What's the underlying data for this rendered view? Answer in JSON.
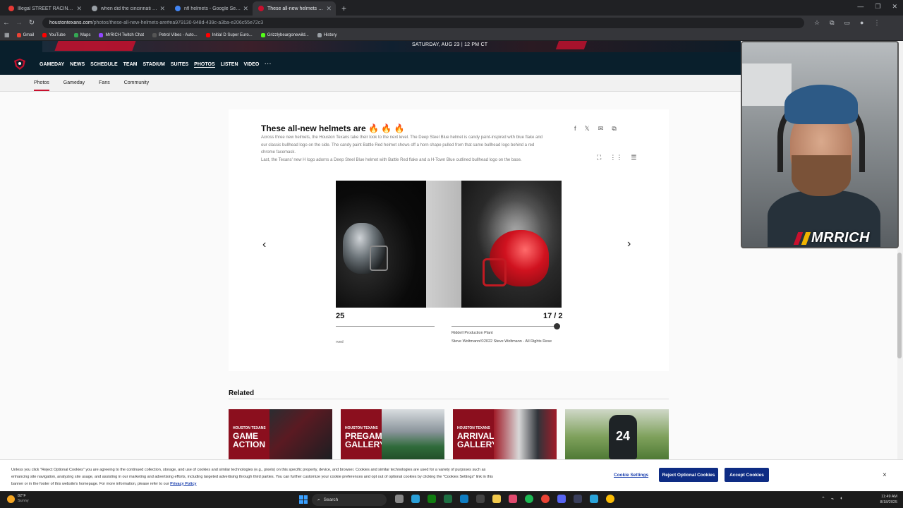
{
  "browser": {
    "tabs": [
      {
        "title": "Illegal STREET RACING in JAPAN",
        "color": "#e53935",
        "active": false
      },
      {
        "title": "when did the cincinnati bengals",
        "color": "#9aa0a6",
        "active": false
      },
      {
        "title": "nfl helmets - Google Search",
        "color": "#4285f4",
        "active": false
      },
      {
        "title": "These all-new helmets are 🔥🔥",
        "color": "#c8102e",
        "active": true
      }
    ],
    "new_tab": "+",
    "url_host": "houstontexans.com",
    "url_path": "/photos/these-all-new-helmets-are#ea979130-948d-439c-a3ba-e206c55e72c3",
    "bookmarks": [
      {
        "label": "Gmail",
        "color": "#ea4335"
      },
      {
        "label": "YouTube",
        "color": "#ff0000"
      },
      {
        "label": "Maps",
        "color": "#34a853"
      },
      {
        "label": "MrRICH Twitch Chat",
        "color": "#9146ff"
      },
      {
        "label": "Petrol Vibes - Auto...",
        "color": "#555555"
      },
      {
        "label": "Initial D Super Euro...",
        "color": "#ff0000"
      },
      {
        "label": "Grizzlybeargonewild...",
        "color": "#53fc18"
      },
      {
        "label": "History",
        "color": "#9aa0a6"
      }
    ]
  },
  "site": {
    "banner_date": "SATURDAY, AUG 23 | 12 PM CT",
    "nav": [
      "GAMEDAY",
      "NEWS",
      "SCHEDULE",
      "TEAM",
      "STADIUM",
      "SUITES",
      "PHOTOS",
      "LISTEN",
      "VIDEO"
    ],
    "nav_active": "PHOTOS",
    "nav_more": "···",
    "subnav": [
      "Photos",
      "Gameday",
      "Fans",
      "Community"
    ]
  },
  "gallery": {
    "title": "These all-new helmets are 🔥 🔥 🔥",
    "description_1": "Across three new helmets, the Houston Texans take their look to the next level. The Deep Steel Blue helmet is candy paint-inspired with blue flake and our classic bullhead logo on the side. The candy paint Battle Red helmet shows off a horn shape pulled from that same bullhead logo behind a red chrome facemask.",
    "description_2": "Last, the Texans' new H logo adorns a Deep Steel Blue helmet with Battle Red flake and a H-Town Blue outlined bullhead logo on the base.",
    "left_counter": "25",
    "left_caption": "rved",
    "right_counter": "17 / 2",
    "right_caption_title": "Riddell Production Plant",
    "right_caption_credit": "Steve Woltmann/©2022 Steve Woltmann - All Rights Rese",
    "prev_arrow": "‹",
    "next_arrow": "›"
  },
  "related": {
    "heading": "Related",
    "cards": [
      {
        "small": "HOUSTON TEXANS",
        "big": "GAME ACTION"
      },
      {
        "small": "HOUSTON TEXANS",
        "big": "PREGAME GALLERY"
      },
      {
        "small": "HOUSTON TEXANS",
        "big": "ARRIVAL GALLERY"
      },
      {
        "small": "",
        "big": "24"
      }
    ]
  },
  "cookie": {
    "text": "Unless you click \"Reject Optional Cookies\" you are agreeing to the continued collection, storage, and use of cookies and similar technologies (e.g., pixels) on this specific property, device, and browser. Cookies and similar technologies are used for a variety of purposes such as enhancing site navigation, analyzing site usage, and assisting in our marketing and advertising efforts, including targeted advertising through third parties. You can further customize your cookie preferences and opt out of optional cookies by clicking the \"Cookies Settings\" link in this banner or in the footer of this website's homepage. For more information, please refer to our",
    "privacy_link": "Privacy Policy",
    "settings": "Cookie Settings",
    "reject": "Reject Optional Cookies",
    "accept": "Accept Cookies",
    "close": "×"
  },
  "taskbar": {
    "temp": "82°F",
    "weather": "Sunny",
    "search": "Search",
    "time": "11:49 AM",
    "date": "8/18/2025"
  },
  "webcam": {
    "brand": "MRRICH"
  }
}
